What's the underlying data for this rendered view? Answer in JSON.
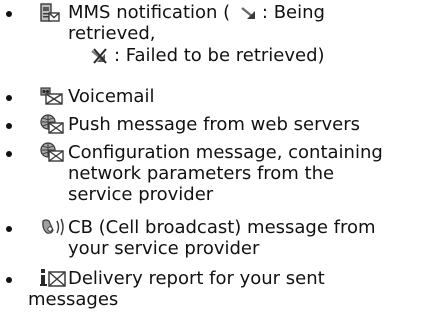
{
  "items": [
    {
      "icon": "mms-notification-icon",
      "lines": [
        "MMS notification (",
        ": Being",
        "retrieved,",
        ": Failed to be retrieved)"
      ],
      "sub_icons": [
        "downloading-arrow-icon",
        "failed-download-icon"
      ]
    },
    {
      "icon": "voicemail-icon",
      "lines": [
        "Voicemail"
      ]
    },
    {
      "icon": "push-message-icon",
      "lines": [
        "Push message from web servers"
      ]
    },
    {
      "icon": "configuration-message-icon",
      "lines": [
        "Configuration message, containing",
        "network parameters from the",
        "service provider"
      ]
    },
    {
      "icon": "cell-broadcast-icon",
      "lines": [
        "CB (Cell broadcast) message from",
        "your service provider"
      ]
    },
    {
      "icon": "delivery-report-icon",
      "lines": [
        "Delivery report for your sent",
        "messages"
      ]
    }
  ],
  "colors": {
    "text": "#111111",
    "icon_dark": "#3a3a3a",
    "icon_mid": "#8a8a8a",
    "icon_light": "#d0d0d0"
  }
}
